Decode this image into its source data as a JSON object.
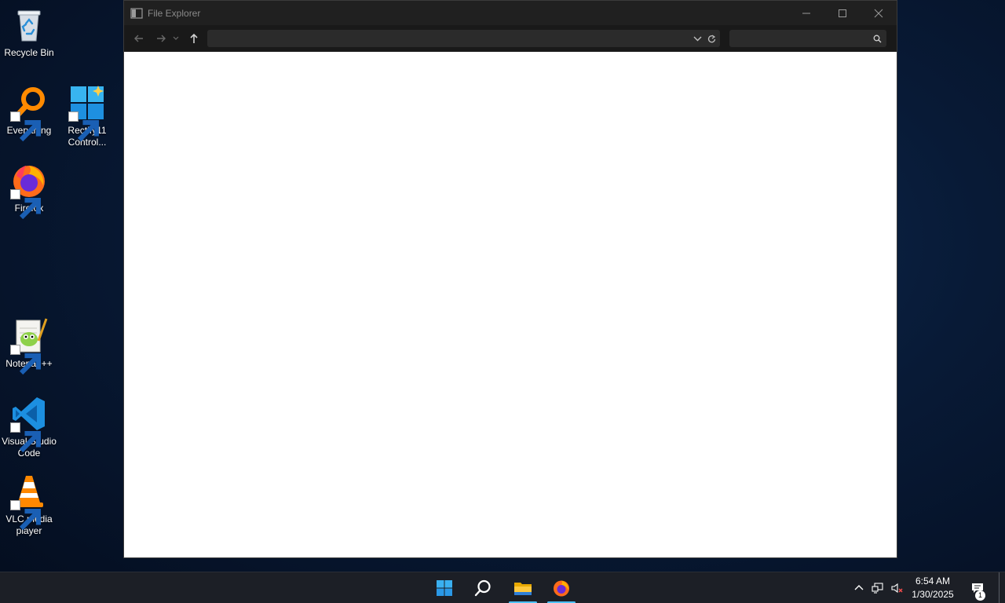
{
  "desktop": {
    "icons": [
      {
        "label": "Recycle Bin",
        "icon": "recycle-bin-icon"
      },
      {
        "label": "Everything",
        "icon": "everything-search-icon"
      },
      {
        "label": "Rectify11 Control...",
        "icon": "rectify11-icon"
      },
      {
        "label": "Firefox",
        "icon": "firefox-icon"
      },
      {
        "label": "Notepad++",
        "icon": "notepadplusplus-icon"
      },
      {
        "label": "Visual Studio Code",
        "icon": "vscode-icon"
      },
      {
        "label": "VLC media player",
        "icon": "vlc-icon"
      }
    ]
  },
  "window": {
    "title": "File Explorer",
    "address_value": "",
    "search_placeholder": "",
    "controls": [
      "minimize-icon",
      "maximize-icon",
      "close-icon"
    ]
  },
  "taskbar": {
    "apps": [
      {
        "name": "Start",
        "icon": "windows-start-icon"
      },
      {
        "name": "Search",
        "icon": "search-icon"
      },
      {
        "name": "File Explorer",
        "icon": "folder-icon",
        "active": true
      },
      {
        "name": "Firefox",
        "icon": "firefox-icon",
        "active": true
      }
    ],
    "time": "6:54 AM",
    "date": "1/30/2025",
    "notification_count": "1"
  },
  "colors": {
    "accent": "#4cc2ff",
    "taskbar": "#1c1f26",
    "window_chrome": "#202020",
    "content_bg": "#ffffff"
  }
}
